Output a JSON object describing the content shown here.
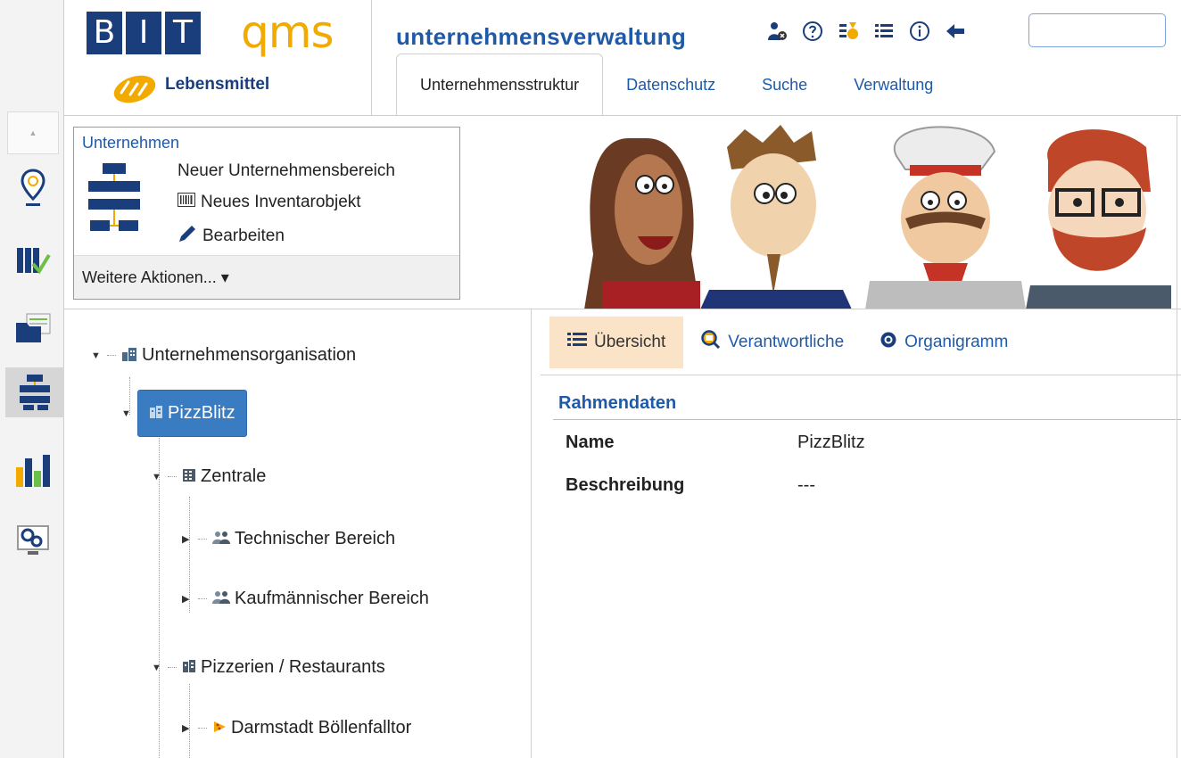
{
  "logo": {
    "letters": [
      "B",
      "I",
      "T"
    ],
    "suffix": "qms",
    "subtitle": "Lebensmittel"
  },
  "header": {
    "title": "unternehmensverwaltung",
    "toolbar_icons": [
      "user-admin-icon",
      "help-icon",
      "medal-icon",
      "list-icon",
      "info-icon",
      "back-arrow-icon"
    ],
    "search": {
      "value": "",
      "placeholder": ""
    },
    "tabs": [
      {
        "label": "Unternehmensstruktur",
        "active": true
      },
      {
        "label": "Datenschutz",
        "active": false
      },
      {
        "label": "Suche",
        "active": false
      },
      {
        "label": "Verwaltung",
        "active": false
      }
    ]
  },
  "rail": {
    "items": [
      "location-pin-icon",
      "binders-check-icon",
      "folder-document-icon",
      "org-structure-icon",
      "bar-chart-icon",
      "key-monitor-icon"
    ],
    "active_index": 3
  },
  "actions": {
    "title": "Unternehmen",
    "items": [
      {
        "label": "Neuer Unternehmensbereich",
        "icon": ""
      },
      {
        "label": "Neues Inventarobjekt",
        "icon": "barcode-icon"
      },
      {
        "label": "Bearbeiten",
        "icon": "pencil-icon"
      }
    ],
    "more": "Weitere Aktionen... ▾"
  },
  "tree": {
    "nodes": [
      {
        "label": "Unternehmensorganisation",
        "toggle": "▼",
        "icon": "org-building-icon"
      },
      {
        "label": "PizzBlitz",
        "toggle": "▼",
        "icon": "company-icon",
        "selected": true
      },
      {
        "label": "Zentrale",
        "toggle": "▼",
        "icon": "headquarters-icon"
      },
      {
        "label": "Technischer Bereich",
        "toggle": "▶",
        "icon": "team-icon"
      },
      {
        "label": "Kaufmännischer Bereich",
        "toggle": "▶",
        "icon": "team-icon"
      },
      {
        "label": "Pizzerien / Restaurants",
        "toggle": "▼",
        "icon": "company-icon"
      },
      {
        "label": "Darmstadt Böllenfalltor",
        "toggle": "▶",
        "icon": "pizza-icon"
      }
    ]
  },
  "detail": {
    "tabs": [
      {
        "label": "Übersicht",
        "icon": "list-icon",
        "active": true
      },
      {
        "label": "Verantwortliche",
        "icon": "calendar-search-icon",
        "active": false
      },
      {
        "label": "Organigramm",
        "icon": "target-icon",
        "active": false
      }
    ],
    "section_title": "Rahmendaten",
    "fields": [
      {
        "label": "Name",
        "value": "PizzBlitz"
      },
      {
        "label": "Beschreibung",
        "value": "---"
      }
    ]
  },
  "colors": {
    "brand_blue": "#1a3d7c",
    "link_blue": "#1f5aa8",
    "brand_orange": "#f2a900",
    "selection_blue": "#3a7cc1",
    "active_tab_bg": "#fbe3c7"
  }
}
